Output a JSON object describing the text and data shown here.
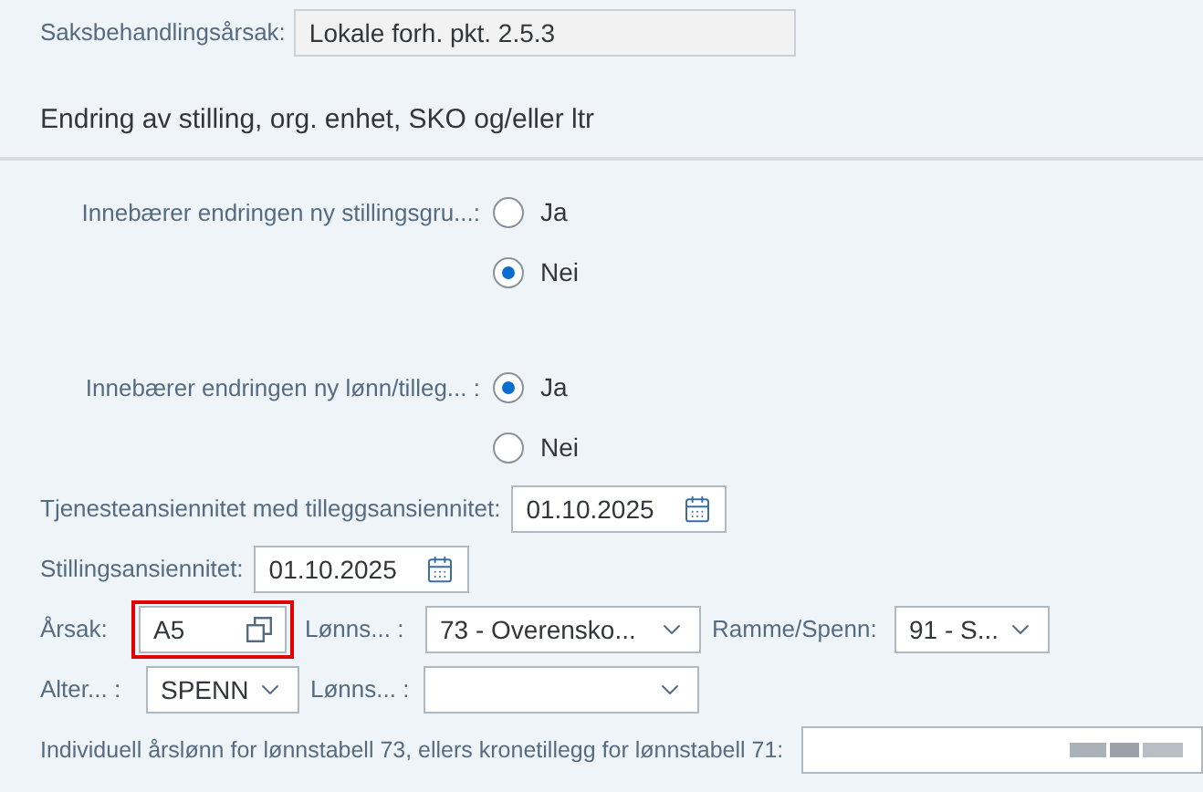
{
  "reason": {
    "label": "Saksbehandlingsårsak:",
    "value": "Lokale forh. pkt. 2.5.3"
  },
  "section_title": "Endring av stilling, org. enhet, SKO og/eller ltr",
  "radio_groups": [
    {
      "label": "Innebærer endringen ny stillingsgru...:",
      "options": [
        {
          "label": "Ja",
          "selected": false
        },
        {
          "label": "Nei",
          "selected": true
        }
      ]
    },
    {
      "label": "Innebærer endringen ny lønn/tilleg... :",
      "options": [
        {
          "label": "Ja",
          "selected": true
        },
        {
          "label": "Nei",
          "selected": false
        }
      ]
    }
  ],
  "date_fields": [
    {
      "label": "Tjenesteansiennitet med tilleggsansiennitet:",
      "value": "01.10.2025"
    },
    {
      "label": "Stillingsansiennitet:",
      "value": "01.10.2025"
    }
  ],
  "field_rows": [
    {
      "items": [
        {
          "kind": "value_help",
          "label": "Årsak:",
          "value": "A5",
          "highlighted": true
        },
        {
          "kind": "dropdown",
          "label": "Lønns... :",
          "value": "73 - Overensko..."
        },
        {
          "kind": "dropdown",
          "label": "Ramme/Spenn:",
          "value": "91 - S..."
        }
      ]
    },
    {
      "items": [
        {
          "kind": "dropdown",
          "label": "Alter... :",
          "value": "SPENN"
        },
        {
          "kind": "dropdown",
          "label": "Lønns... :"
        }
      ]
    }
  ],
  "salary": {
    "label": "Individuell årslønn for lønnstabell 73, ellers kronetillegg for lønnstabell 71:",
    "value_obscured": true
  }
}
